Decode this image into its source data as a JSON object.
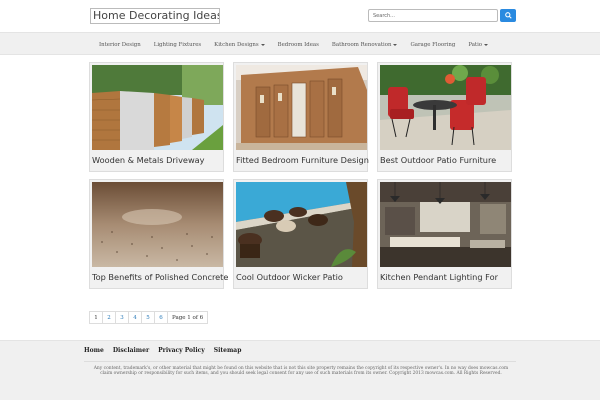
{
  "header": {
    "site_title": "Home Decorating Ideas",
    "search_placeholder": "Search...",
    "search_icon": "search-icon"
  },
  "nav": {
    "items": [
      {
        "label": "Interior Design",
        "dropdown": false
      },
      {
        "label": "Lighting Fixtures",
        "dropdown": false
      },
      {
        "label": "Kitchen Designs",
        "dropdown": true
      },
      {
        "label": "Bedroom Ideas",
        "dropdown": false
      },
      {
        "label": "Bathroom Renovation",
        "dropdown": true
      },
      {
        "label": "Garage Flooring",
        "dropdown": false
      },
      {
        "label": "Patio",
        "dropdown": true
      }
    ]
  },
  "cards": [
    {
      "title": "Wooden & Metals Driveway",
      "image": "fence-photo"
    },
    {
      "title": "Fitted Bedroom Furniture Design",
      "image": "wardrobe-photo"
    },
    {
      "title": "Best Outdoor Patio Furniture",
      "image": "patio-chairs-photo"
    },
    {
      "title": "Top Benefits of Polished Concrete",
      "image": "terrazzo-floor-photo"
    },
    {
      "title": "Cool Outdoor Wicker Patio",
      "image": "poolside-wicker-photo"
    },
    {
      "title": "Kitchen Pendant Lighting For",
      "image": "kitchen-pendant-photo"
    }
  ],
  "pagination": {
    "pages": [
      "1",
      "2",
      "3",
      "4",
      "5",
      "6"
    ],
    "current": "1",
    "info": "Page 1 of 6"
  },
  "footer": {
    "links": [
      "Home",
      "Disclaimer",
      "Privacy Policy",
      "Sitemap"
    ],
    "copyright": "Any content, trademark's, or other material that might be found on this website that is not this site property remains the copyright of its respective owner's. In no way does mowcas.com claim ownership or responsibility for such items, and you should seek legal consent for any use of such materials from its owner. Copyright 2013 mowcas.com. All Rights Reserved."
  },
  "colors": {
    "accent": "#2a8ae0",
    "link": "#2a7ab8",
    "nav_bg": "#f0f0f0"
  }
}
